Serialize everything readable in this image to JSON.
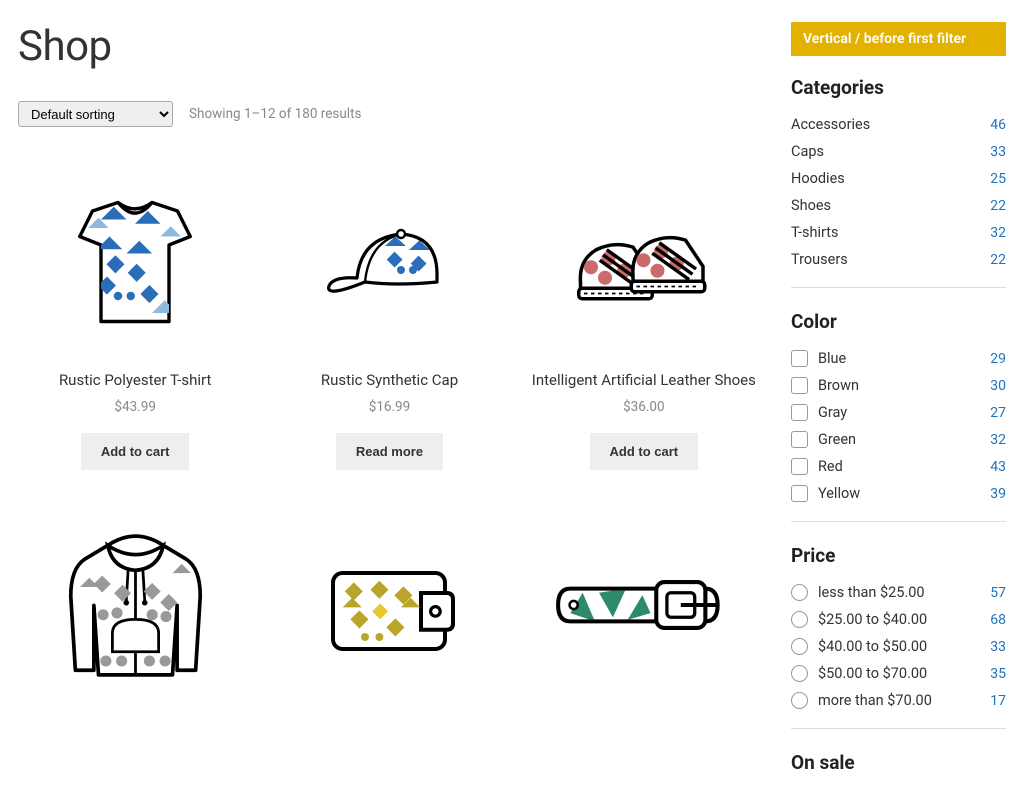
{
  "page_title": "Shop",
  "sorting": {
    "selected": "Default sorting"
  },
  "result_count": "Showing 1–12 of 180 results",
  "products": [
    {
      "title": "Rustic Polyester T-shirt",
      "price": "$43.99",
      "action": "Add to cart"
    },
    {
      "title": "Rustic Synthetic Cap",
      "price": "$16.99",
      "action": "Read more"
    },
    {
      "title": "Intelligent Artificial Leather Shoes",
      "price": "$36.00",
      "action": "Add to cart"
    },
    {
      "title": "",
      "price": "",
      "action": ""
    },
    {
      "title": "",
      "price": "",
      "action": ""
    },
    {
      "title": "",
      "price": "",
      "action": ""
    }
  ],
  "sidebar": {
    "notice": "Vertical / before first filter",
    "categories": {
      "title": "Categories",
      "items": [
        {
          "label": "Accessories",
          "count": "46"
        },
        {
          "label": "Caps",
          "count": "33"
        },
        {
          "label": "Hoodies",
          "count": "25"
        },
        {
          "label": "Shoes",
          "count": "22"
        },
        {
          "label": "T-shirts",
          "count": "32"
        },
        {
          "label": "Trousers",
          "count": "22"
        }
      ]
    },
    "color": {
      "title": "Color",
      "items": [
        {
          "label": "Blue",
          "count": "29"
        },
        {
          "label": "Brown",
          "count": "30"
        },
        {
          "label": "Gray",
          "count": "27"
        },
        {
          "label": "Green",
          "count": "32"
        },
        {
          "label": "Red",
          "count": "43"
        },
        {
          "label": "Yellow",
          "count": "39"
        }
      ]
    },
    "price": {
      "title": "Price",
      "items": [
        {
          "label": "less than $25.00",
          "count": "57"
        },
        {
          "label": "$25.00 to $40.00",
          "count": "68"
        },
        {
          "label": "$40.00 to $50.00",
          "count": "33"
        },
        {
          "label": "$50.00 to $70.00",
          "count": "35"
        },
        {
          "label": "more than $70.00",
          "count": "17"
        }
      ]
    },
    "onsale": {
      "title": "On sale"
    }
  }
}
